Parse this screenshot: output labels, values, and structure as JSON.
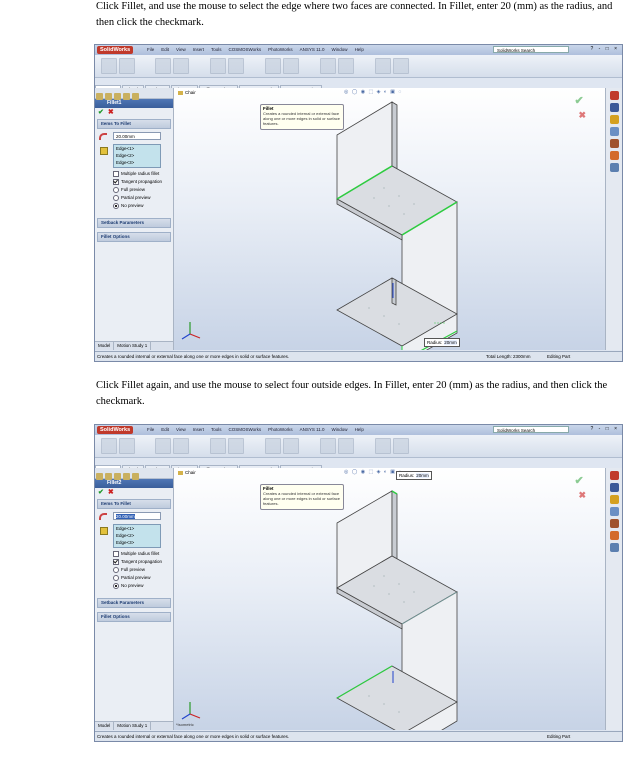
{
  "instructions": {
    "step1": "Click Fillet, and use the mouse to select the edge where two faces are connected. In Fillet, enter 20 (mm) as the radius, and then click the checkmark.",
    "step2": "Click Fillet again, and use the mouse to select four outside edges. In Fillet, enter 20 (mm) as the radius, and then click the checkmark."
  },
  "app": {
    "logo": "SolidWorks",
    "menu": [
      "File",
      "Edit",
      "View",
      "Insert",
      "Tools",
      "COSMOSWorks",
      "PhotoWorks",
      "ANSYS 11.0",
      "Window",
      "Help"
    ],
    "search_placeholder": "SolidWorks Search",
    "window_buttons": "? - □ ×",
    "tabs": [
      "Features",
      "Sketch",
      "Evaluate",
      "DimXpert",
      "Office Products",
      "COSMOSWorks",
      "COSMOSMotion"
    ],
    "active_tab": "Features",
    "heads_up": "◎ ◯ ◉ ⬚ ◈ ◐ ▣ ◌"
  },
  "shot1": {
    "panel_title": "Fillet1",
    "section_items": "Items To Fillet",
    "radius_value": "20.00mm",
    "edges": [
      "Edge<1>",
      "Edge<2>",
      "Edge<3>"
    ],
    "options": [
      {
        "label": "Multiple radius fillet",
        "kind": "check",
        "on": false
      },
      {
        "label": "Tangent propagation",
        "kind": "check",
        "on": true
      },
      {
        "label": "Full preview",
        "kind": "radio",
        "on": false
      },
      {
        "label": "Partial preview",
        "kind": "radio",
        "on": false
      },
      {
        "label": "No preview",
        "kind": "radio",
        "on": true
      }
    ],
    "section_setback": "Setback Parameters",
    "section_options": "Fillet Options",
    "bottom_tabs": [
      "Model",
      "Motion Study 1"
    ],
    "breadcrumb": "Chair",
    "tooltip_title": "Fillet",
    "tooltip_text": "Creates a rounded internal or external face along one or more edges in solid or surface features.",
    "radius_label": "Radius:",
    "radius_tag_value": "20mm",
    "status_text": "Creates a rounded internal or external face along one or more edges in solid or surface features.",
    "status_length": "Total Length: 2300mm",
    "status_mode": "Editing Part"
  },
  "shot2": {
    "panel_title": "Fillet2",
    "section_items": "Items To Fillet",
    "radius_value": "20.00mm",
    "edges": [
      "Edge<1>",
      "Edge<2>",
      "Edge<3>"
    ],
    "options": [
      {
        "label": "Multiple radius fillet",
        "kind": "check",
        "on": false
      },
      {
        "label": "Tangent propagation",
        "kind": "check",
        "on": true
      },
      {
        "label": "Full preview",
        "kind": "radio",
        "on": false
      },
      {
        "label": "Partial preview",
        "kind": "radio",
        "on": false
      },
      {
        "label": "No preview",
        "kind": "radio",
        "on": true
      }
    ],
    "section_setback": "Setback Parameters",
    "section_options": "Fillet Options",
    "bottom_tabs": [
      "Model",
      "Motion Study 1"
    ],
    "breadcrumb": "Chair",
    "tooltip_title": "Fillet",
    "tooltip_text": "Creates a rounded internal or external face along one or more edges in solid or surface features.",
    "radius_label": "Radius:",
    "radius_tag_value": "20mm",
    "status_text": "Creates a rounded internal or external face along one or more edges in solid or surface features.",
    "status_mode": "Editing Part",
    "viewport_label": "*Isometric"
  },
  "colors": {
    "selected_edge": "#2ecc40",
    "accent": "#3a5e9b",
    "ok": "#1d9a2a",
    "cancel": "#cc2222"
  }
}
